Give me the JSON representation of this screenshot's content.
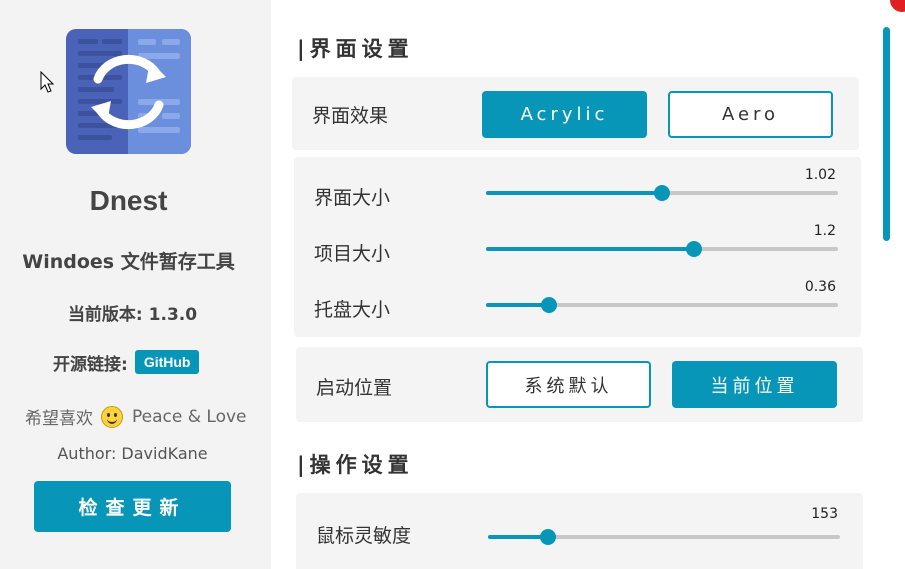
{
  "sidebar": {
    "app_name": "Dnest",
    "app_desc": "Windoes 文件暂存工具",
    "version_label": "当前版本: 1.3.0",
    "source_label": "开源链接:",
    "github_label": "GitHub",
    "love_prefix": "希望喜欢",
    "love_suffix": "Peace & Love",
    "author": "Author: DavidKane",
    "check_update_label": "检查更新"
  },
  "interface_section": {
    "title": "|界面设置",
    "effect": {
      "label": "界面效果",
      "options": [
        "Acrylic",
        "Aero"
      ],
      "selected": "Acrylic"
    },
    "sliders": [
      {
        "label": "界面大小",
        "value": "1.02",
        "fraction": 0.5
      },
      {
        "label": "项目大小",
        "value": "1.2",
        "fraction": 0.59
      },
      {
        "label": "托盘大小",
        "value": "0.36",
        "fraction": 0.18
      }
    ],
    "start_position": {
      "label": "启动位置",
      "options": [
        "系统默认",
        "当前位置"
      ],
      "selected": "当前位置"
    }
  },
  "operation_section": {
    "title": "|操作设置",
    "sliders": [
      {
        "label": "鼠标灵敏度",
        "value": "153",
        "fraction": 0.17
      }
    ]
  },
  "colors": {
    "accent": "#0796b8",
    "sidebar_bg": "#f3f3f3",
    "card_bg": "#f4f4f4"
  }
}
